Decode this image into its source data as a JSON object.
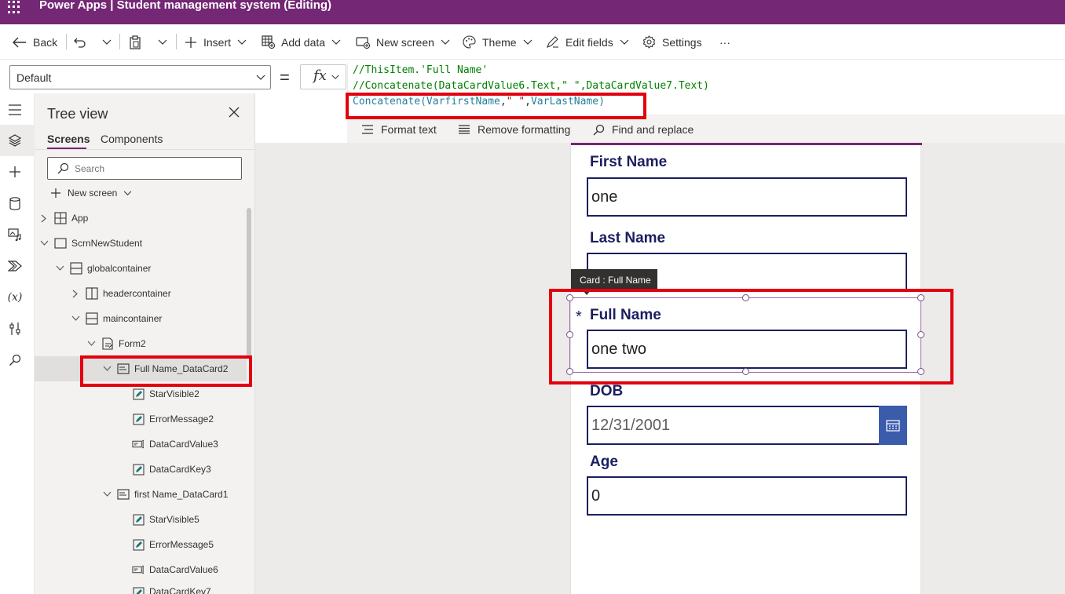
{
  "app": {
    "title": "Power Apps  |  Student management system (Editing)"
  },
  "toolbar": {
    "back_label": "Back",
    "insert_label": "Insert",
    "add_data_label": "Add data",
    "new_screen_label": "New screen",
    "theme_label": "Theme",
    "edit_fields_label": "Edit fields",
    "settings_label": "Settings",
    "more_label": "···"
  },
  "formula_bar": {
    "property_value": "Default",
    "equals": "=",
    "fx_label": "fx",
    "line1": "//ThisItem.'Full Name'",
    "line2": "//Concatenate(DataCardValue6.Text,\" \",DataCardValue7.Text)",
    "line3_fn": "Concatenate(",
    "line3_var1": "VarfirstName",
    "line3_mid": ",",
    "line3_str": "\" \"",
    "line3_comma": ",",
    "line3_var2": "VarLastName",
    "line3_close": ")",
    "format_text_label": "Format text",
    "remove_formatting_label": "Remove formatting",
    "find_replace_label": "Find and replace"
  },
  "tree_view": {
    "title": "Tree view",
    "tabs": [
      {
        "label": "Screens"
      },
      {
        "label": "Components"
      }
    ],
    "search_placeholder": "Search",
    "new_screen_label": "New screen",
    "nodes": [
      {
        "label": "App"
      },
      {
        "label": "ScrnNewStudent"
      },
      {
        "label": "globalcontainer"
      },
      {
        "label": "headercontainer"
      },
      {
        "label": "maincontainer"
      },
      {
        "label": "Form2"
      },
      {
        "label": "Full Name_DataCard2"
      },
      {
        "label": "StarVisible2"
      },
      {
        "label": "ErrorMessage2"
      },
      {
        "label": "DataCardValue3"
      },
      {
        "label": "DataCardKey3"
      },
      {
        "label": "first Name_DataCard1"
      },
      {
        "label": "StarVisible5"
      },
      {
        "label": "ErrorMessage5"
      },
      {
        "label": "DataCardValue6"
      },
      {
        "label": "DataCardKey7"
      }
    ]
  },
  "form": {
    "first_name_label": "First Name",
    "first_name_value": "one",
    "last_name_label": "Last Name",
    "last_name_value": "",
    "tooltip": "Card : Full Name",
    "required_star": "*",
    "full_name_label": "Full Name",
    "full_name_value": "one two",
    "dob_label": "DOB",
    "dob_value": "12/31/2001",
    "age_label": "Age",
    "age_value": "0"
  },
  "colors": {
    "brand": "#742774",
    "form_text": "#1b1f5f",
    "calendar_button": "#3b5bab",
    "annotation_red": "#e3000f"
  }
}
